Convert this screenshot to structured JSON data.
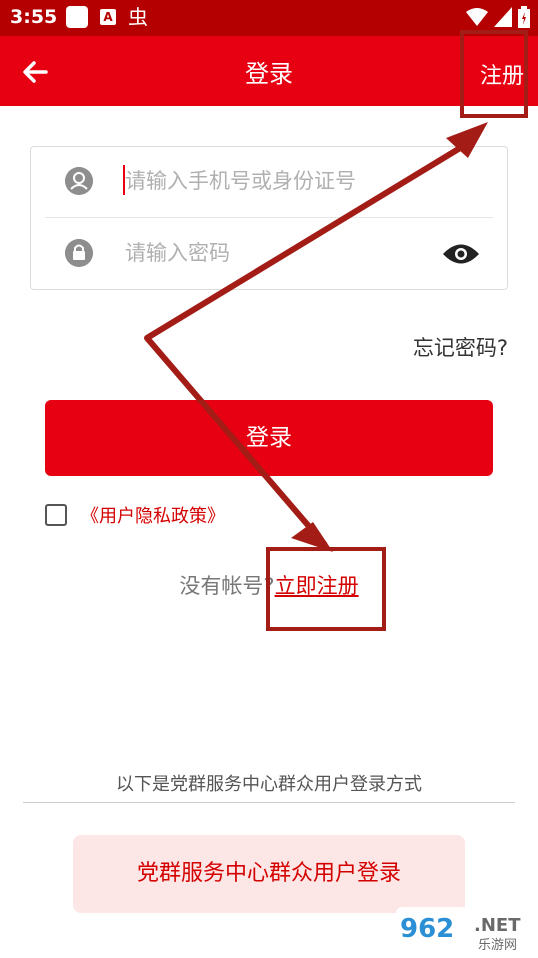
{
  "status_bar": {
    "time": "3:55",
    "bug_glyph": "虫"
  },
  "app_bar": {
    "title": "登录",
    "register_label": "注册"
  },
  "form": {
    "phone_placeholder": "请输入手机号或身份证号",
    "password_placeholder": "请输入密码"
  },
  "forgot_password": "忘记密码?",
  "login_button": "登录",
  "privacy": {
    "label": "《用户隐私政策》"
  },
  "no_account": {
    "prefix": "没有帐号?",
    "link": "立即注册"
  },
  "mass_login": {
    "caption": "以下是党群服务中心群众用户登录方式",
    "button": "党群服务中心群众用户登录"
  },
  "watermark": {
    "number": "962",
    "suffix": ".NET",
    "sub": "乐游网"
  },
  "colors": {
    "primary": "#e60012",
    "status_bar": "#b40000",
    "annotation": "#a31c16",
    "soft_button": "#fde6e6"
  },
  "icons": [
    "back-arrow-icon",
    "user-icon",
    "lock-icon",
    "eye-icon",
    "wifi-icon",
    "signal-icon",
    "battery-icon"
  ]
}
